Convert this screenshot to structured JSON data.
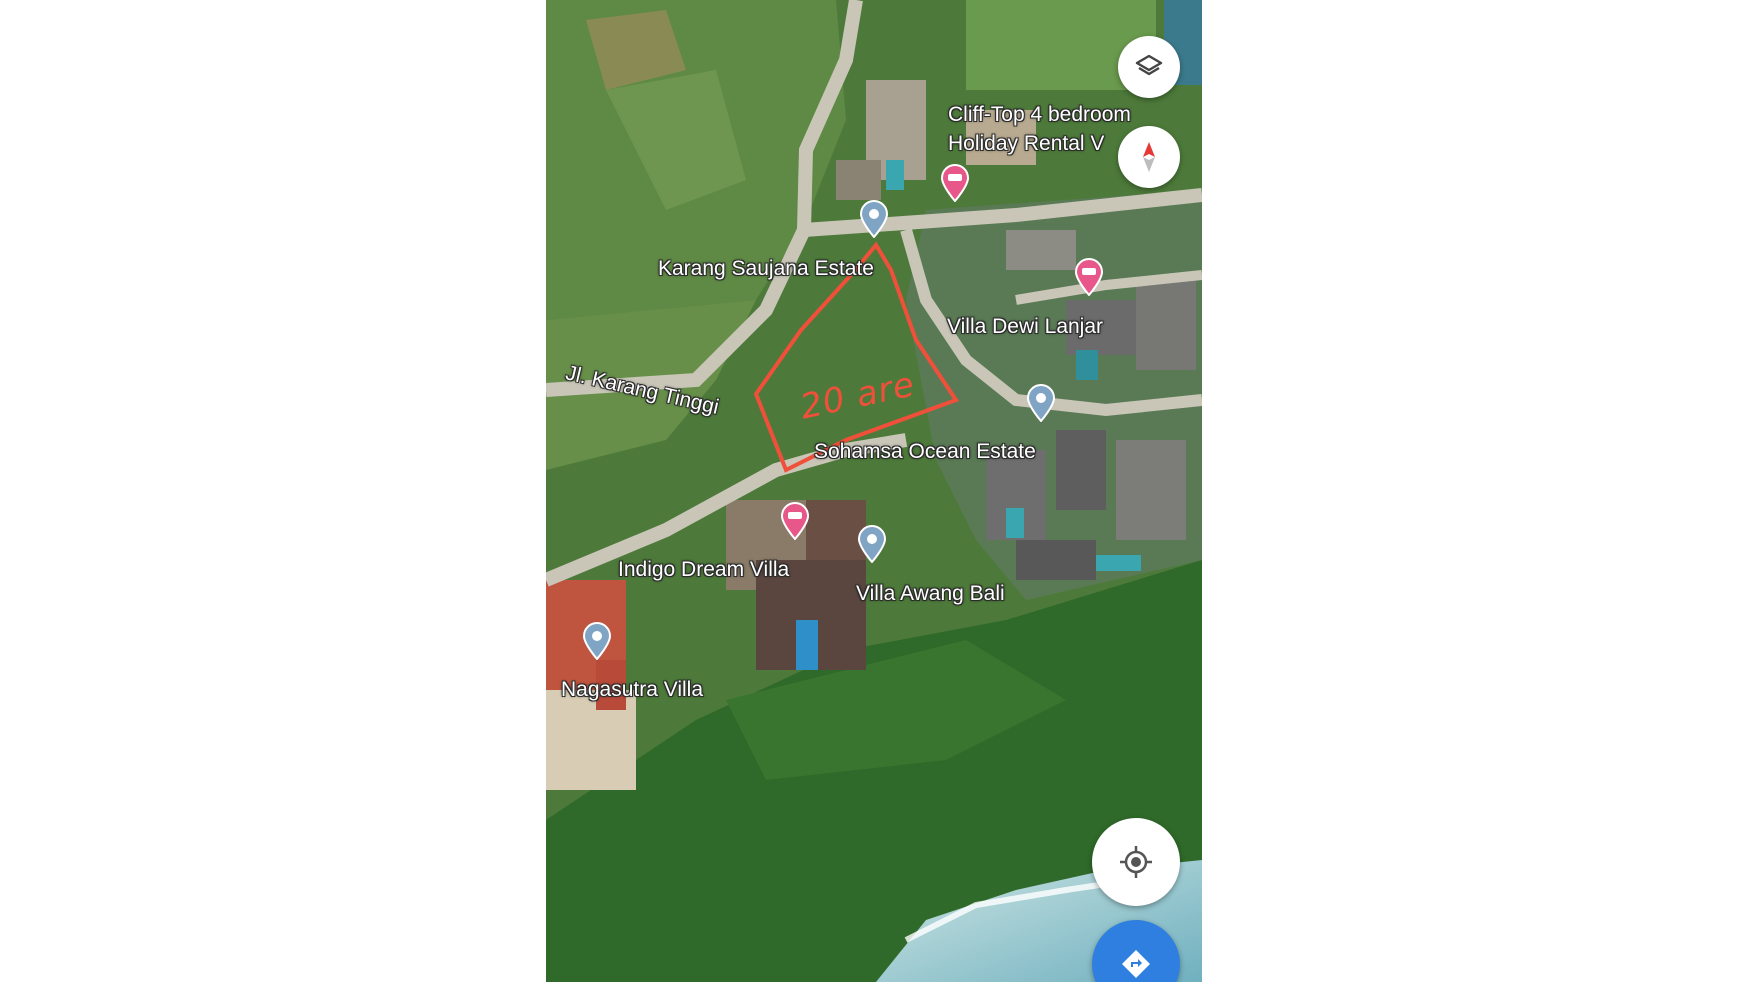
{
  "map": {
    "places": [
      {
        "name": "Cliff-Top 4 bedroom",
        "type": "label"
      },
      {
        "name": "Holiday Rental V",
        "type": "label"
      },
      {
        "name": "Karang Saujana Estate",
        "type": "label"
      },
      {
        "name": "Villa Dewi Lanjar",
        "type": "label"
      },
      {
        "name": "Jl. Karang Tinggi",
        "type": "road"
      },
      {
        "name": "Sohamsa Ocean Estate",
        "type": "label"
      },
      {
        "name": "Indigo Dream Villa",
        "type": "label"
      },
      {
        "name": "Villa Awang Bali",
        "type": "label"
      },
      {
        "name": "Nagasutra Villa",
        "type": "label"
      }
    ],
    "annotation": {
      "text": "20 are",
      "color": "#f0503a"
    },
    "controls": {
      "layers_icon": "layers-icon",
      "compass_icon": "compass-icon",
      "my_location_icon": "my-location-icon",
      "directions_icon": "directions-icon"
    },
    "pin_colors": {
      "hotel": "#e8578a",
      "generic": "#7fa4c4"
    }
  }
}
